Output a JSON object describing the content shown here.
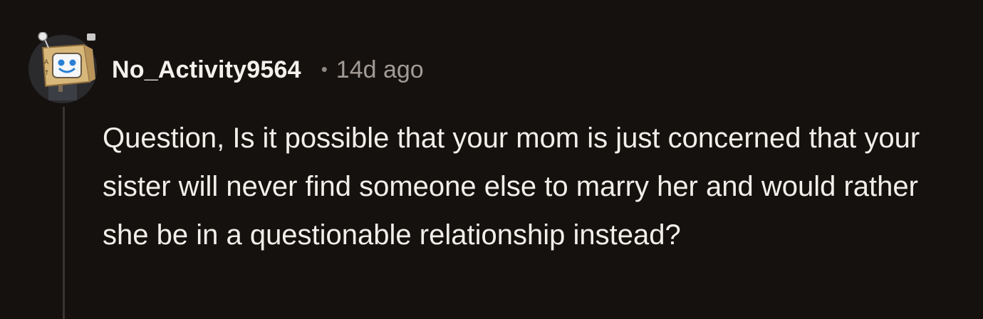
{
  "comment": {
    "author": "No_Activity9564",
    "separator": "•",
    "timestamp": "14d ago",
    "body": "Question, Is it possible that your mom is just concerned that your sister will never find someone else to marry her and would rather she be in a questionable relationship instead?",
    "avatar_icon": "snoo-robot-avatar-icon"
  },
  "colors": {
    "background": "#15110f",
    "text": "#f2eeea",
    "muted": "#a29b96",
    "thread_line": "#3a3532"
  }
}
